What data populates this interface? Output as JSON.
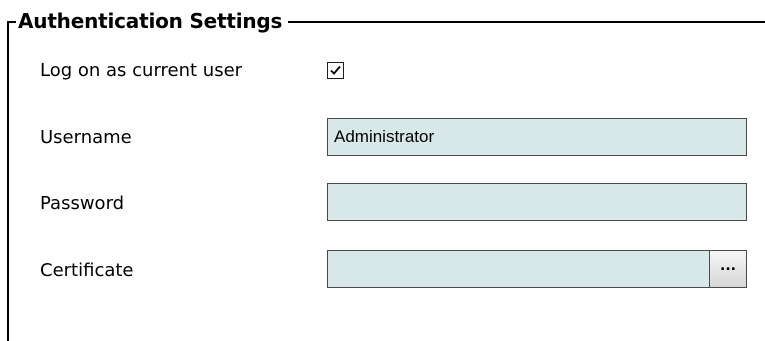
{
  "group": {
    "title": "Authentication Settings"
  },
  "fields": {
    "log_on_current_user": {
      "label": "Log on as current user",
      "checked": true
    },
    "username": {
      "label": "Username",
      "value": "Administrator"
    },
    "password": {
      "label": "Password",
      "value": ""
    },
    "certificate": {
      "label": "Certificate",
      "value": "",
      "browse_label": "..."
    }
  },
  "colors": {
    "field_background": "#d8e8e8",
    "border": "#4a4a4a"
  }
}
